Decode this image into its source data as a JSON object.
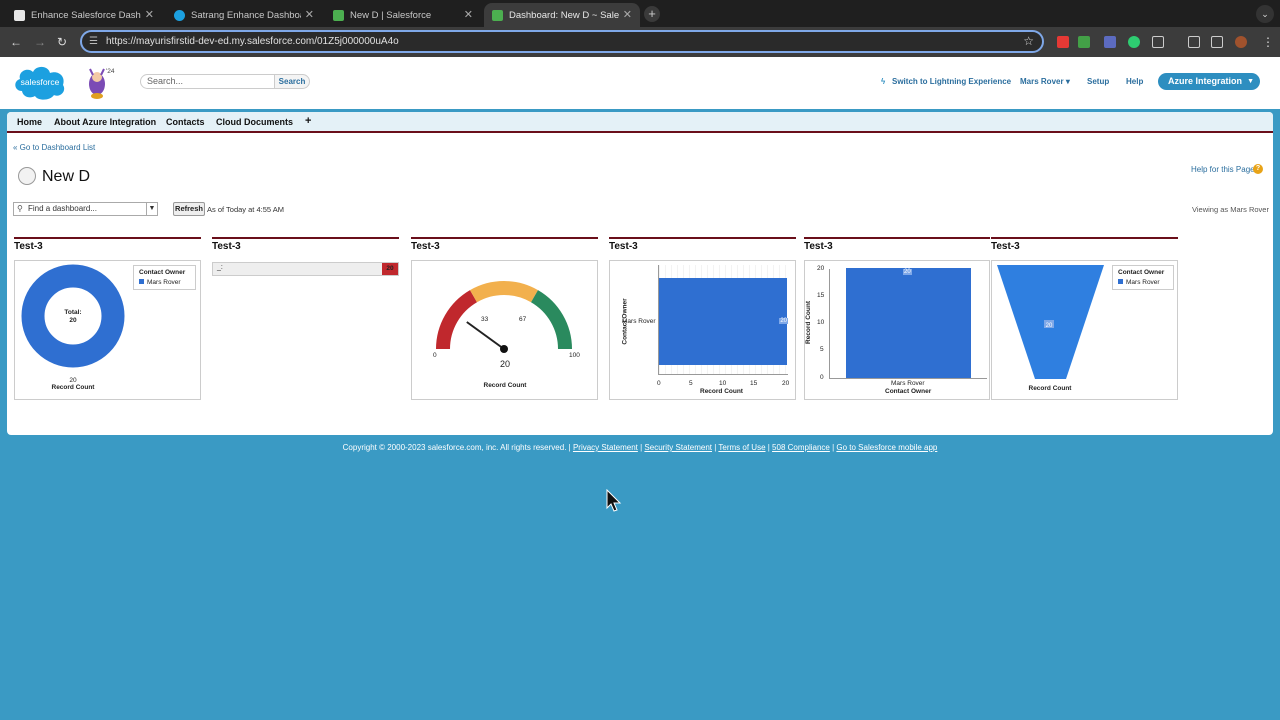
{
  "browser": {
    "tabs": [
      {
        "title": "Enhance Salesforce Dashboa",
        "close": "✕"
      },
      {
        "title": "Satrang Enhance Dashboard",
        "close": "✕"
      },
      {
        "title": "New D | Salesforce",
        "close": "✕"
      },
      {
        "title": "Dashboard: New D ~ Salesfor",
        "close": "✕"
      }
    ],
    "url": "https://mayurisfirstid-dev-ed.my.salesforce.com/01Z5j000000uA4o",
    "new_tab": "+"
  },
  "header": {
    "logo_text": "salesforce",
    "mascot_badge": "'24",
    "search_placeholder": "Search...",
    "search_button": "Search",
    "lightning_link": "Switch to Lightning Experience",
    "user_menu": "Mars Rover",
    "setup": "Setup",
    "help": "Help",
    "app_menu": "Azure Integration"
  },
  "nav": {
    "tabs": [
      "Home",
      "About Azure Integration",
      "Contacts",
      "Cloud Documents"
    ],
    "add": "+"
  },
  "dashboard": {
    "back_link": "« Go to Dashboard List",
    "title": "New D",
    "help_link": "Help for this Page",
    "find_placeholder": "Find a dashboard...",
    "refresh": "Refresh",
    "as_of": "As of Today at 4:55 AM",
    "viewing_as": "Viewing as Mars Rover"
  },
  "components": [
    {
      "header": "Test-3",
      "type": "donut",
      "total_label": "Total:",
      "total_value": "20",
      "value": "20",
      "axis_label": "Record Count",
      "legend_title": "Contact Owner",
      "legend_item": "Mars Rover",
      "color": "#2f6fd1"
    },
    {
      "header": "Test-3",
      "type": "metric",
      "label": "_:",
      "value": "20",
      "color": "#c0282d"
    },
    {
      "header": "Test-3",
      "type": "gauge",
      "min": "0",
      "max": "100",
      "breakpoints": [
        "33",
        "67"
      ],
      "value": "20",
      "axis_label": "Record Count",
      "fraction": 0.2,
      "colors": [
        "#c0282d",
        "#f2b04d",
        "#2a8a5e"
      ]
    },
    {
      "header": "Test-3",
      "type": "hbar",
      "category": "Mars Rover",
      "value": "20",
      "ylabel": "Contact Owner",
      "xlabel": "Record Count",
      "ticks": [
        "0",
        "5",
        "10",
        "15",
        "20"
      ],
      "color": "#2f6fd1"
    },
    {
      "header": "Test-3",
      "type": "vbar",
      "category": "Mars Rover",
      "value": "20",
      "ylabel": "Record Count",
      "xlabel": "Contact Owner",
      "ticks": [
        "20",
        "15",
        "10",
        "5",
        "0"
      ],
      "color": "#2f6fd1"
    },
    {
      "header": "Test-3",
      "type": "funnel",
      "value": "20",
      "axis_label": "Record Count",
      "legend_title": "Contact Owner",
      "legend_item": "Mars Rover",
      "color": "#2f7fe0"
    }
  ],
  "footer": {
    "copyright": "Copyright © 2000-2023 salesforce.com, inc. All rights reserved. |",
    "links": [
      "Privacy Statement",
      "Security Statement",
      "Terms of Use",
      "508 Compliance",
      "Go to Salesforce mobile app"
    ]
  }
}
